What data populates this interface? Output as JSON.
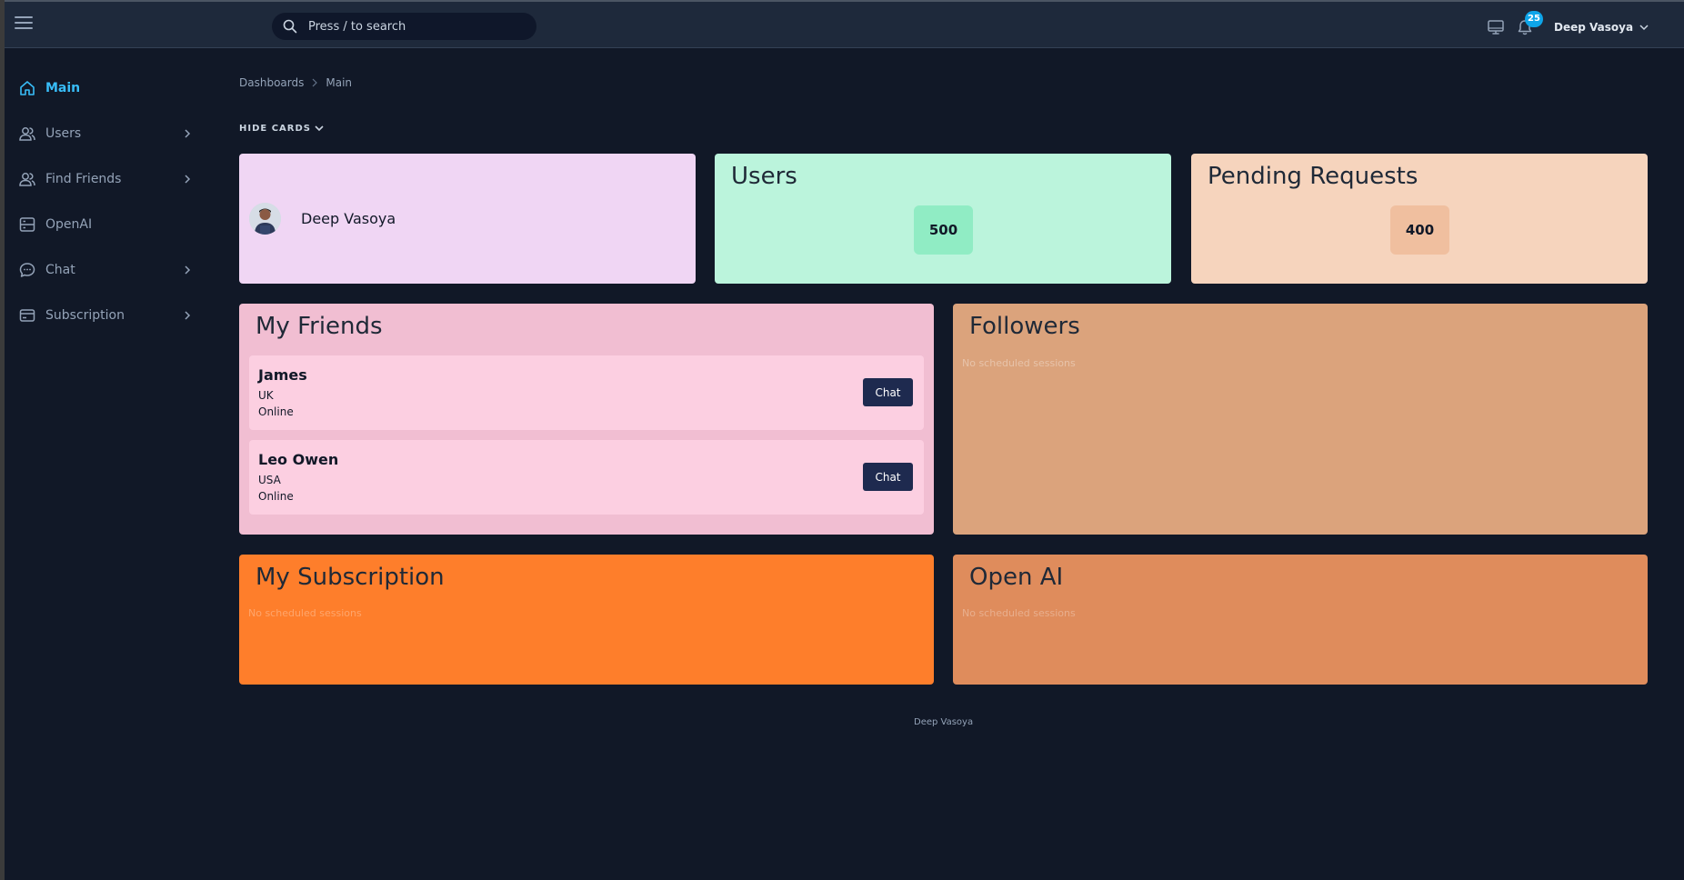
{
  "header": {
    "search_placeholder": "Press / to search",
    "notification_count": "25",
    "user_name": "Deep Vasoya",
    "icons": [
      "menu-icon",
      "search-icon",
      "monitor-icon",
      "bell-icon",
      "chevron-down-icon"
    ]
  },
  "sidebar": {
    "items": [
      {
        "label": "Main",
        "icon": "home-icon",
        "active": true
      },
      {
        "label": "Users",
        "icon": "users-icon",
        "has_submenu": true
      },
      {
        "label": "Find Friends",
        "icon": "users-icon",
        "has_submenu": true
      },
      {
        "label": "OpenAI",
        "icon": "server-icon"
      },
      {
        "label": "Chat",
        "icon": "chat-bubble-icon",
        "has_submenu": true
      },
      {
        "label": "Subscription",
        "icon": "card-icon",
        "has_submenu": true
      }
    ]
  },
  "breadcrumb": {
    "items": [
      "Dashboards",
      "Main"
    ]
  },
  "hide_cards_label": "HIDE CARDS",
  "cards": {
    "profile": {
      "name": "Deep Vasoya"
    },
    "users": {
      "title": "Users",
      "value": "500"
    },
    "pending": {
      "title": "Pending Requests",
      "value": "400"
    },
    "friends": {
      "title": "My Friends",
      "list": [
        {
          "name": "James",
          "country": "UK",
          "status": "Online",
          "button": "Chat"
        },
        {
          "name": "Leo Owen",
          "country": "USA",
          "status": "Online",
          "button": "Chat"
        }
      ]
    },
    "followers": {
      "title": "Followers",
      "empty": "No scheduled sessions"
    },
    "subscription": {
      "title": "My Subscription",
      "empty": "No scheduled sessions"
    },
    "openai": {
      "title": "Open AI",
      "empty": "No scheduled sessions"
    }
  },
  "footer": {
    "text": "Deep Vasoya"
  },
  "colors": {
    "background": "#111827",
    "topbar": "#1e293b",
    "accent": "#38bdf8",
    "badge": "#0ea5e9",
    "profile_card": "#f0d6f4",
    "users_card": "#bbf4dc",
    "pending_card": "#f6d4bd",
    "friends_card": "#f1bed2",
    "followers_card": "#dba37c",
    "subscription_card": "#fe7e2b",
    "openai_card": "#df8c5c",
    "chat_button": "#1e2a4f"
  }
}
